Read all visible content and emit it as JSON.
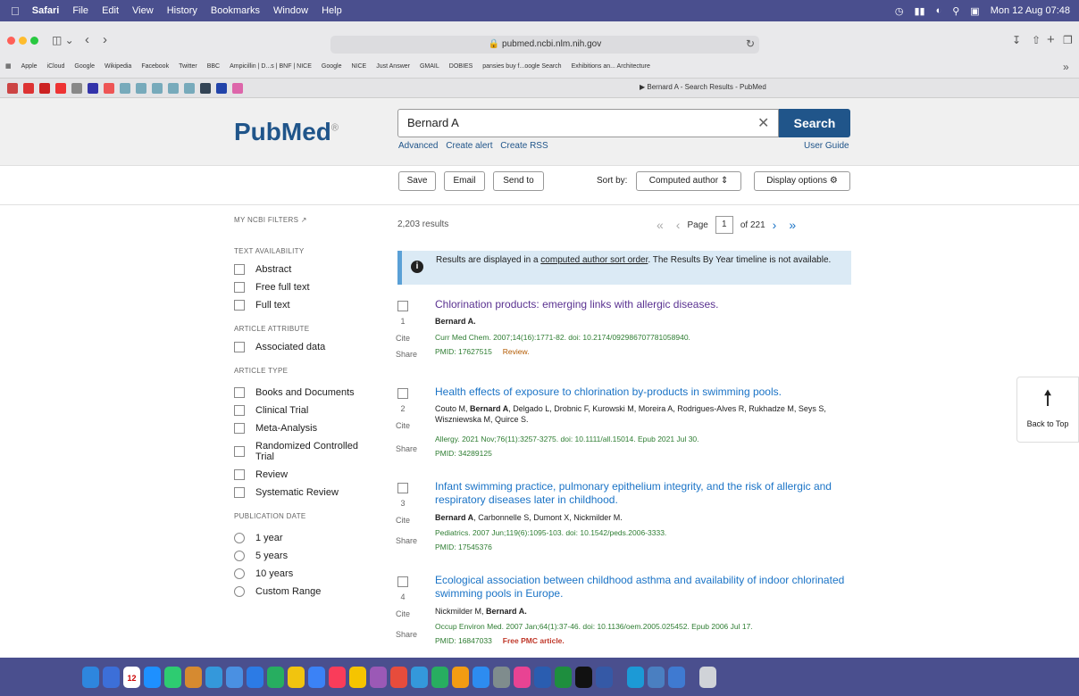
{
  "menubar": {
    "app": "Safari",
    "items": [
      "File",
      "Edit",
      "View",
      "History",
      "Bookmarks",
      "Window",
      "Help"
    ],
    "clock": "Mon 12 Aug 07:48"
  },
  "browser": {
    "url": "pubmed.ncbi.nlm.nih.gov",
    "tab_title": "Bernard A - Search Results - PubMed",
    "bookmarks": [
      "Apple",
      "iCloud",
      "Google",
      "Wikipedia",
      "Facebook",
      "Twitter",
      "BBC",
      "Ampicillin | D...s | BNF | NICE",
      "Google",
      "NICE",
      "Just Answer",
      "GMAIL",
      "DOBIES",
      "pansies buy f...oogle Search",
      "Exhibitions an... Architecture"
    ]
  },
  "header": {
    "logo": "PubMed",
    "search_value": "Bernard A",
    "search_button": "Search",
    "links": [
      "Advanced",
      "Create alert",
      "Create RSS"
    ],
    "user_guide": "User Guide"
  },
  "actions": {
    "save": "Save",
    "email": "Email",
    "send_to": "Send to",
    "sort_label": "Sort by:",
    "sort_value": "Computed author",
    "display_options": "Display options"
  },
  "sidebar": {
    "my_filters": "MY NCBI FILTERS",
    "sections": [
      {
        "heading": "TEXT AVAILABILITY",
        "items": [
          "Abstract",
          "Free full text",
          "Full text"
        ]
      },
      {
        "heading": "ARTICLE ATTRIBUTE",
        "items": [
          "Associated data"
        ]
      },
      {
        "heading": "ARTICLE TYPE",
        "items": [
          "Books and Documents",
          "Clinical Trial",
          "Meta-Analysis",
          "Randomized Controlled Trial",
          "Review",
          "Systematic Review"
        ]
      },
      {
        "heading": "PUBLICATION DATE",
        "items": [
          "1 year",
          "5 years",
          "10 years",
          "Custom Range"
        ]
      }
    ]
  },
  "results": {
    "count": "2,203 results",
    "page_label": "Page",
    "page": "1",
    "of_pages": "of 221",
    "notice_pre": "Results are displayed in a ",
    "notice_link": "computed author sort order",
    "notice_post": ". The Results By Year timeline is not available.",
    "cite": "Cite",
    "share": "Share",
    "items": [
      {
        "num": "1",
        "title": "Chlorination products: emerging links with allergic diseases.",
        "authors_html": "<b>Bernard A.</b>",
        "citation": "Curr Med Chem. 2007;14(16):1771-82. doi: 10.2174/092986707781058940.",
        "pmid": "PMID: 17627515",
        "tag": "Review.",
        "free": ""
      },
      {
        "num": "2",
        "title": "Health effects of exposure to chlorination by-products in swimming pools.",
        "authors_html": "Couto M, <b>Bernard A</b>, Delgado L, Drobnic F, Kurowski M, Moreira A, Rodrigues-Alves R, Rukhadze M, Seys S, Wiszniewska M, Quirce S.",
        "citation": "Allergy. 2021 Nov;76(11):3257-3275. doi: 10.1111/all.15014. Epub 2021 Jul 30.",
        "pmid": "PMID: 34289125",
        "tag": "",
        "free": ""
      },
      {
        "num": "3",
        "title": "Infant swimming practice, pulmonary epithelium integrity, and the risk of allergic and respiratory diseases later in childhood.",
        "authors_html": "<b>Bernard A</b>, Carbonnelle S, Dumont X, Nickmilder M.",
        "citation": "Pediatrics. 2007 Jun;119(6):1095-103. doi: 10.1542/peds.2006-3333.",
        "pmid": "PMID: 17545376",
        "tag": "",
        "free": ""
      },
      {
        "num": "4",
        "title": "Ecological association between childhood asthma and availability of indoor chlorinated swimming pools in Europe.",
        "authors_html": "Nickmilder M, <b>Bernard A.</b>",
        "citation": "Occup Environ Med. 2007 Jan;64(1):37-46. doi: 10.1136/oem.2005.025452. Epub 2006 Jul 17.",
        "pmid": "PMID: 16847033",
        "tag": "",
        "free": "Free PMC article."
      }
    ]
  },
  "back_to_top": "Back to Top",
  "dock": {
    "calendar_date": "12"
  },
  "colors": {
    "brand": "#20558a",
    "link": "#1a73c6",
    "visited": "#5a3291",
    "citation": "#2e7d32",
    "menubar": "#4a4f8e"
  }
}
